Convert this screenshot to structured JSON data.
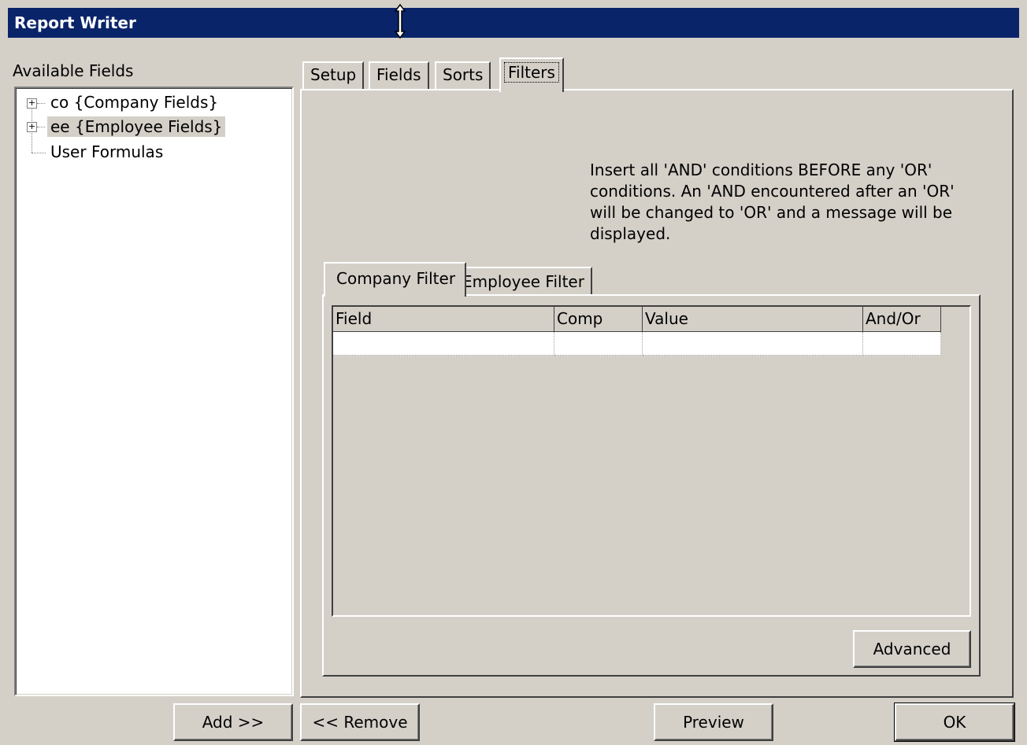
{
  "window": {
    "title": "Report Writer"
  },
  "available_fields": {
    "label": "Available Fields",
    "tree": [
      {
        "label": "co {Company Fields}",
        "expandable": true,
        "selected": false
      },
      {
        "label": "ee {Employee Fields}",
        "expandable": true,
        "selected": true
      },
      {
        "label": "User Formulas",
        "expandable": false,
        "selected": false
      }
    ]
  },
  "tabs": [
    {
      "label": "Setup"
    },
    {
      "label": "Fields"
    },
    {
      "label": "Sorts"
    },
    {
      "label": "Filters",
      "active": true
    }
  ],
  "filters": {
    "instructions": "Insert all 'AND' conditions BEFORE any 'OR' conditions. An 'AND encountered after an 'OR' will be changed to 'OR' and a message will be displayed.",
    "subtabs": [
      {
        "label": "Company Filter",
        "active": true
      },
      {
        "label": "Employee Filter"
      }
    ],
    "grid": {
      "columns": [
        "Field",
        "Comp",
        "Value",
        "And/Or"
      ],
      "rows": [
        [
          "",
          "",
          "",
          ""
        ]
      ]
    },
    "advanced_label": "Advanced"
  },
  "buttons": {
    "add": "Add >>",
    "remove": "<< Remove",
    "preview": "Preview",
    "ok": "OK"
  },
  "colors": {
    "titlebar": "#0a246a",
    "face": "#d4d0c8",
    "selection": "#d4d0c8"
  },
  "cursor_icon": "vertical-resize-cursor-icon"
}
